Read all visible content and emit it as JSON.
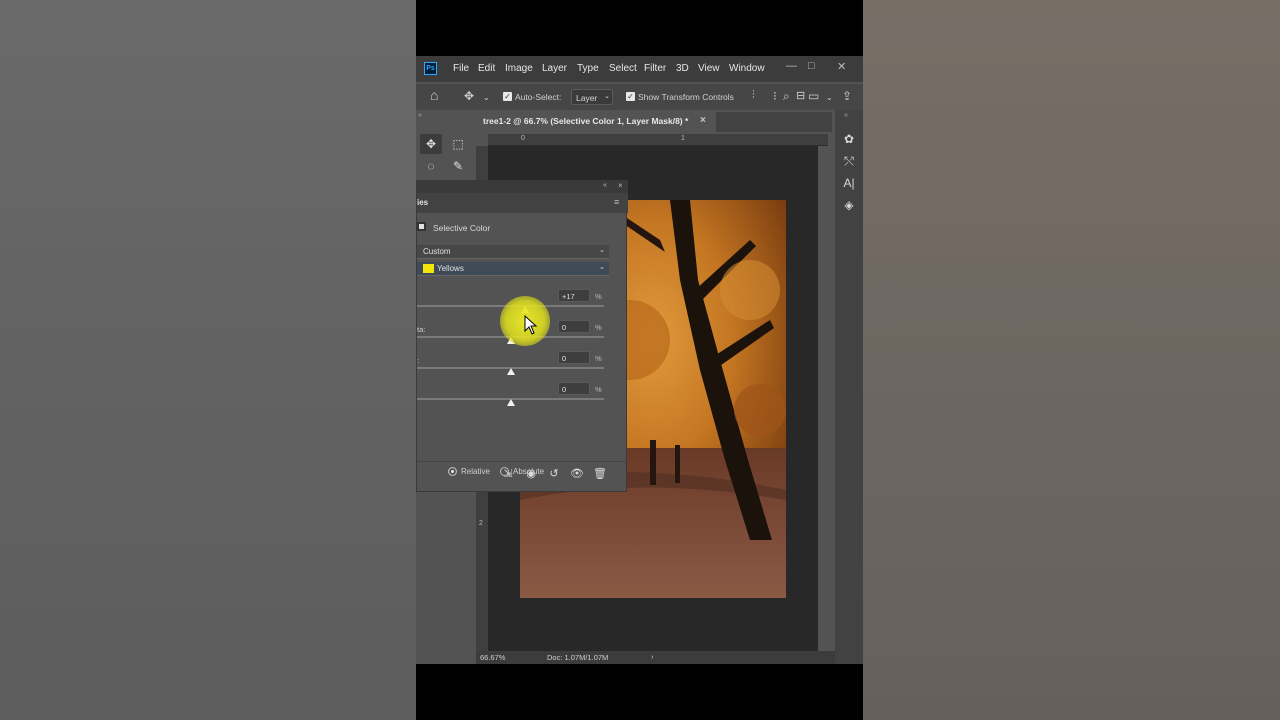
{
  "app": {
    "logo": "Ps",
    "menu": [
      "File",
      "Edit",
      "Image",
      "Layer",
      "Type",
      "Select",
      "Filter",
      "3D",
      "View",
      "Window"
    ],
    "window_controls": [
      "—",
      "□",
      "✕"
    ]
  },
  "options_bar": {
    "auto_select_label": "Auto-Select:",
    "auto_select_checked": true,
    "layer_select_value": "Layer",
    "show_transform_label": "Show Transform Controls",
    "show_transform_checked": true
  },
  "document": {
    "tab_title": "tree1-2 @ 66.7% (Selective Color 1, Layer Mask/8) *",
    "tab_close": "×",
    "ruler_marks_top": [
      "0",
      "1"
    ],
    "ruler_marks_left": [
      "2"
    ]
  },
  "status": {
    "zoom": "66.67%",
    "doc_info": "Doc: 1.07M/1.07M",
    "arrow": "›"
  },
  "properties_panel": {
    "tab_label": "ies",
    "adjustment_name": "Selective Color",
    "preset": "Custom",
    "colors": "Yellows",
    "swatch_color": "#f1e40b",
    "sliders": [
      {
        "label": "",
        "value": "+17",
        "unit": "%",
        "level": 0.58
      },
      {
        "label": "ta:",
        "value": "0",
        "unit": "%",
        "level": 0.5
      },
      {
        "label": ":",
        "value": "0",
        "unit": "%",
        "level": 0.5
      },
      {
        "label": "",
        "value": "0",
        "unit": "%",
        "level": 0.5
      }
    ],
    "method_relative": "Relative",
    "method_absolute": "Absolute",
    "selected_method": "Relative"
  },
  "accent_colors": {
    "ps_blue": "#31a8ff",
    "cursor_highlight": "#eeee28"
  }
}
